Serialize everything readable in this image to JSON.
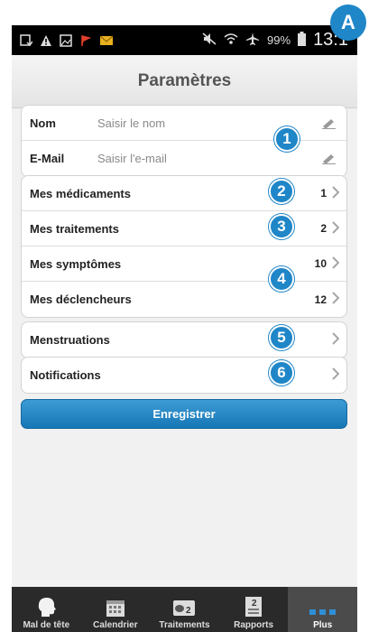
{
  "badge_a": "A",
  "status_bar": {
    "battery": "99%",
    "time": "13:1"
  },
  "header": {
    "title": "Paramètres"
  },
  "profile": {
    "name_label": "Nom",
    "name_placeholder": "Saisir le nom",
    "email_label": "E-Mail",
    "email_placeholder": "Saisir l'e-mail"
  },
  "lists": [
    {
      "label": "Mes médicaments",
      "count": "1"
    },
    {
      "label": "Mes traitements",
      "count": "2"
    },
    {
      "label": "Mes symptômes",
      "count": "10"
    },
    {
      "label": "Mes déclencheurs",
      "count": "12"
    }
  ],
  "menstruations": {
    "label": "Menstruations"
  },
  "notifications": {
    "label": "Notifications"
  },
  "callouts": [
    "1",
    "2",
    "3",
    "4",
    "5",
    "6"
  ],
  "save_button": "Enregistrer",
  "tabs": [
    {
      "label": "Mal de tête",
      "icon": "head-icon"
    },
    {
      "label": "Calendrier",
      "icon": "calendar-icon"
    },
    {
      "label": "Traitements",
      "icon": "pills-icon"
    },
    {
      "label": "Rapports",
      "icon": "report-icon"
    },
    {
      "label": "Plus",
      "icon": "more-icon",
      "active": true
    }
  ],
  "colors": {
    "accent": "#1f86c8",
    "tabbar": "#2a2a2a"
  }
}
